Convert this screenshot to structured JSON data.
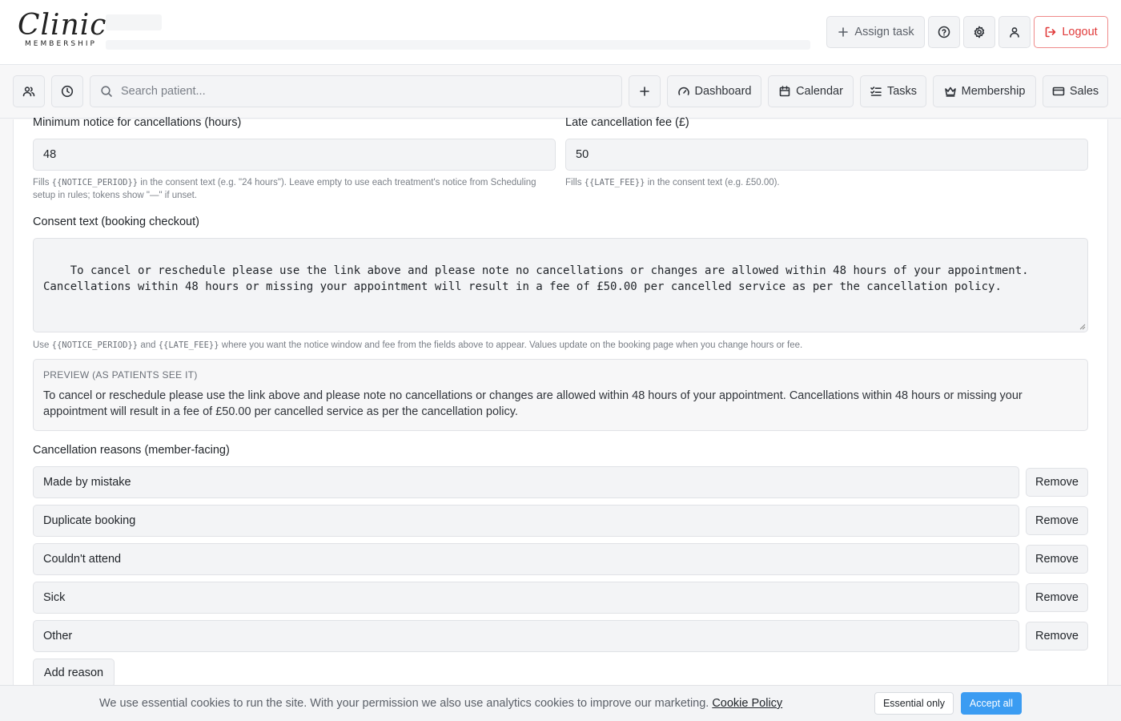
{
  "brand": {
    "logo_script": "Clinic",
    "logo_sub": "MEMBERSHIP"
  },
  "header": {
    "assign_task": "Assign task",
    "logout": "Logout"
  },
  "nav": {
    "search_placeholder": "Search patient...",
    "dashboard": "Dashboard",
    "calendar": "Calendar",
    "tasks": "Tasks",
    "membership": "Membership",
    "sales": "Sales"
  },
  "form": {
    "notice_label": "Minimum notice for cancellations (hours)",
    "notice_value": "48",
    "notice_hint_token": "{{NOTICE_PERIOD}}",
    "notice_hint_rest": " in the consent text (e.g. \"24 hours\"). Leave empty to use each treatment's notice from Scheduling setup in rules; tokens show \"—\" if unset.",
    "notice_hint_prefix": "Fills ",
    "fee_label": "Late cancellation fee (£)",
    "fee_value": "50",
    "fee_hint_prefix": "Fills ",
    "fee_hint_token": "{{LATE_FEE}}",
    "fee_hint_rest": " in the consent text (e.g. £50.00).",
    "consent_label": "Consent text (booking checkout)",
    "consent_value": "To cancel or reschedule please use the link above and please note no cancellations or changes are allowed within 48 hours of your appointment.\nCancellations within 48 hours or missing your appointment will result in a fee of £50.00 per cancelled service as per the cancellation policy.",
    "consent_hint_prefix": "Use ",
    "consent_hint_token1": "{{NOTICE_PERIOD}}",
    "consent_hint_mid": " and ",
    "consent_hint_token2": "{{LATE_FEE}}",
    "consent_hint_rest": " where you want the notice window and fee from the fields above to appear. Values update on the booking page when you change hours or fee.",
    "preview_heading": "PREVIEW (AS PATIENTS SEE IT)",
    "preview_text": "To cancel or reschedule please use the link above and please note no cancellations or changes are allowed within 48 hours of your appointment. Cancellations within 48 hours or missing your appointment will result in a fee of £50.00 per cancelled service as per the cancellation policy.",
    "reasons_label": "Cancellation reasons (member-facing)",
    "reasons": [
      {
        "value": "Made by mistake",
        "remove": "Remove"
      },
      {
        "value": "Duplicate booking",
        "remove": "Remove"
      },
      {
        "value": "Couldn't attend",
        "remove": "Remove"
      },
      {
        "value": "Sick",
        "remove": "Remove"
      },
      {
        "value": "Other",
        "remove": "Remove"
      }
    ],
    "add_reason": "Add reason"
  },
  "cookie": {
    "text": "We use essential cookies to run the site. With your permission we also use analytics cookies to improve our marketing.",
    "link": "Cookie Policy",
    "essential": "Essential only",
    "accept": "Accept all",
    "accept_color": "#3b9cf2"
  },
  "colors": {
    "logout": "#e03a3a"
  },
  "icons": [
    "plus-icon",
    "help-circle-icon",
    "gear-icon",
    "user-icon",
    "logout-icon",
    "people-icon",
    "clock-icon",
    "search-icon",
    "gauge-icon",
    "calendar-icon",
    "list-check-icon",
    "crown-icon",
    "credit-card-icon"
  ]
}
